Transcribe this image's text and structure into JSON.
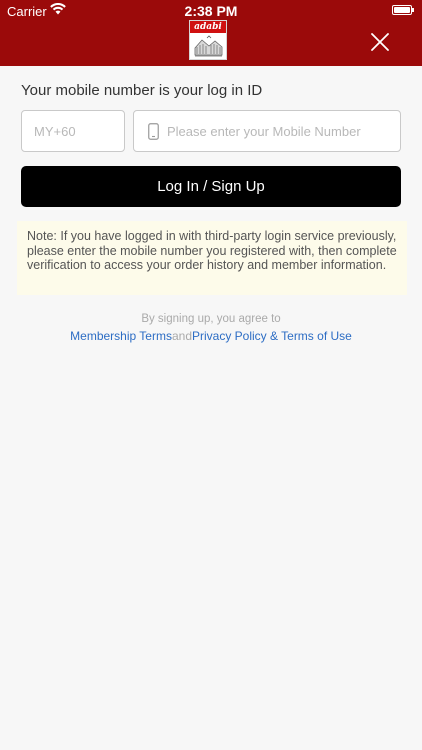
{
  "status_bar": {
    "carrier": "Carrier",
    "time": "2:38 PM",
    "wifi_icon": "wifi-icon",
    "battery_icon": "battery-icon"
  },
  "header": {
    "background_color": "#9b0a0a",
    "logo_text": "adabi",
    "logo_icon": "adabi-logo",
    "close_icon": "close-icon"
  },
  "login": {
    "prompt": "Your mobile number is your log in ID",
    "country_code_placeholder": "MY+60",
    "country_code_value": "",
    "phone_placeholder": "Please enter your Mobile Number",
    "phone_value": "",
    "phone_icon": "mobile-phone-icon",
    "submit_label": "Log In / Sign Up",
    "note": "Note: If you have logged in with third-party login service previously, please enter the mobile number you registered with, then complete verification to access your order history and member information."
  },
  "terms": {
    "agree_text": "By signing up, you agree to",
    "membership_terms": "Membership Terms",
    "and_text": "and",
    "privacy_terms": "Privacy Policy & Terms of Use",
    "link_color": "#2d6dc4"
  }
}
